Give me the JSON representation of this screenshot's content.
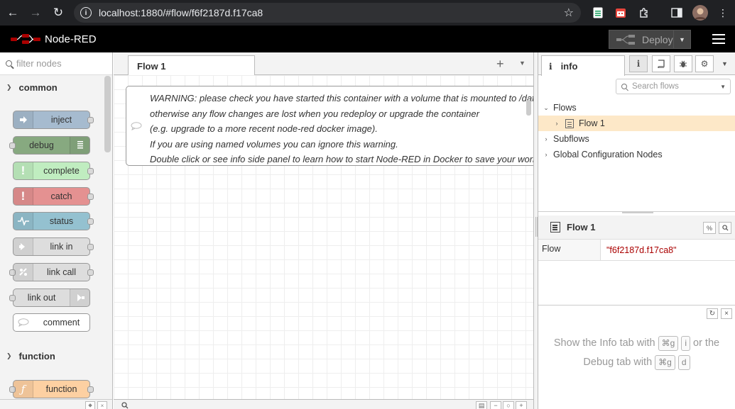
{
  "browser": {
    "url": "localhost:1880/#flow/f6f2187d.f17ca8"
  },
  "header": {
    "app_title": "Node-RED",
    "deploy_label": "Deploy"
  },
  "palette": {
    "filter_placeholder": "filter nodes",
    "categories": [
      {
        "label": "common"
      },
      {
        "label": "function"
      }
    ],
    "nodes": [
      {
        "label": "inject",
        "color": "#a6bbcf"
      },
      {
        "label": "debug",
        "color": "#87a980"
      },
      {
        "label": "complete",
        "color": "#c0edc0"
      },
      {
        "label": "catch",
        "color": "#e49191"
      },
      {
        "label": "status",
        "color": "#94c1d0"
      },
      {
        "label": "link in",
        "color": "#dddddd"
      },
      {
        "label": "link call",
        "color": "#dddddd"
      },
      {
        "label": "link out",
        "color": "#dddddd"
      },
      {
        "label": "comment",
        "color": "#ffffff"
      },
      {
        "label": "function",
        "color": "#fdd0a2"
      }
    ]
  },
  "workspace": {
    "tab_label": "Flow 1",
    "comment_lines": [
      "WARNING: please check you have started this container with a volume that is mounted to /data",
      "otherwise any flow changes are lost when you redeploy or upgrade the container",
      "(e.g. upgrade to a more recent node-red docker image).",
      "If you are using named volumes you can ignore this warning.",
      "Double click or see info side panel to learn how to start Node-RED in Docker to save your work"
    ]
  },
  "sidebar": {
    "tab_label": "info",
    "search_placeholder": "Search flows",
    "tree": {
      "flows": "Flows",
      "flow1": "Flow 1",
      "subflows": "Subflows",
      "global_config": "Global Configuration Nodes"
    },
    "properties": {
      "title": "Flow 1",
      "key": "Flow",
      "value": "\"f6f2187d.f17ca8\""
    },
    "help": {
      "line1_a": "Show the Info tab with",
      "line1_b": "or the",
      "line2_a": "Debug tab with",
      "key_mod": "⌘g",
      "key_i": "i",
      "key_d": "d"
    }
  },
  "colors": {
    "header_bg": "#000000",
    "logo_red": "#aa0000",
    "selected_row": "#fde8c8"
  }
}
